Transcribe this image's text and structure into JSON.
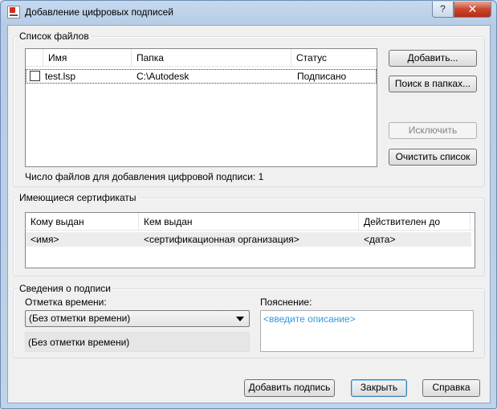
{
  "window": {
    "title": "Добавление цифровых подписей",
    "help_label": "?",
    "close_label": "✕"
  },
  "files": {
    "group_label": "Список файлов",
    "columns": [
      "Имя",
      "Папка",
      "Статус"
    ],
    "rows": [
      {
        "checked": false,
        "name": "test.lsp",
        "folder": "C:\\Autodesk",
        "status": "Подписано"
      }
    ],
    "count_text": "Число файлов для добавления цифровой подписи: 1",
    "buttons": {
      "add": "Добавить...",
      "search": "Поиск в папках...",
      "exclude": "Исключить",
      "clear": "Очистить список"
    }
  },
  "certificates": {
    "group_label": "Имеющиеся сертификаты",
    "columns": [
      "Кому выдан",
      "Кем выдан",
      "Действителен до"
    ],
    "rows": [
      {
        "issued_to": "<имя>",
        "issued_by": "<сертификационная организация>",
        "valid_until": "<дата>"
      }
    ]
  },
  "signature": {
    "group_label": "Сведения о подписи",
    "timestamp_label": "Отметка времени:",
    "timestamp_selected": "(Без отметки времени)",
    "timestamp_readonly": "(Без отметки времени)",
    "comment_label": "Пояснение:",
    "comment_placeholder": "<введите описание>"
  },
  "footer": {
    "add_signature": "Добавить подпись",
    "close": "Закрыть",
    "help": "Справка"
  },
  "colors": {
    "placeholder": "#3399dd",
    "selection_row": "#ececec"
  }
}
